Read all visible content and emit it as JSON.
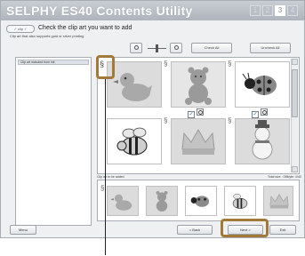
{
  "window": {
    "title": "SELPHY ES40 Contents Utility",
    "steps": [
      "1",
      "2",
      "3",
      "4"
    ],
    "active_step": "3"
  },
  "header": {
    "pill_label": "✓ clip ✓",
    "instruction": "Check the clip art you want to add",
    "sub_instruction": "Clip art that also supports gold or silver printing"
  },
  "toolbar": {
    "check_all_label": "Check All",
    "uncheck_all_label": "Uncheck All"
  },
  "left_panel": {
    "categories": [
      "Clip art included from ink"
    ]
  },
  "clips": [
    {
      "name": "duck",
      "checked": false
    },
    {
      "name": "bear",
      "checked": true
    },
    {
      "name": "ladybug",
      "checked": true
    },
    {
      "name": "bee",
      "checked": false
    },
    {
      "name": "crown",
      "checked": false
    },
    {
      "name": "snowman",
      "checked": false
    }
  ],
  "added": {
    "label": "Clip art to be added",
    "count_text": "Total size : 0Mbyte: 4/40",
    "items": [
      "duck",
      "bear",
      "ladybug",
      "bee",
      "crown"
    ]
  },
  "footer": {
    "menu_label": "Menu",
    "back_label": "< Back",
    "next_label": "Next >",
    "exit_label": "Exit"
  },
  "colors": {
    "callout": "#a3793a",
    "title_bar": "#aeb4bb"
  }
}
